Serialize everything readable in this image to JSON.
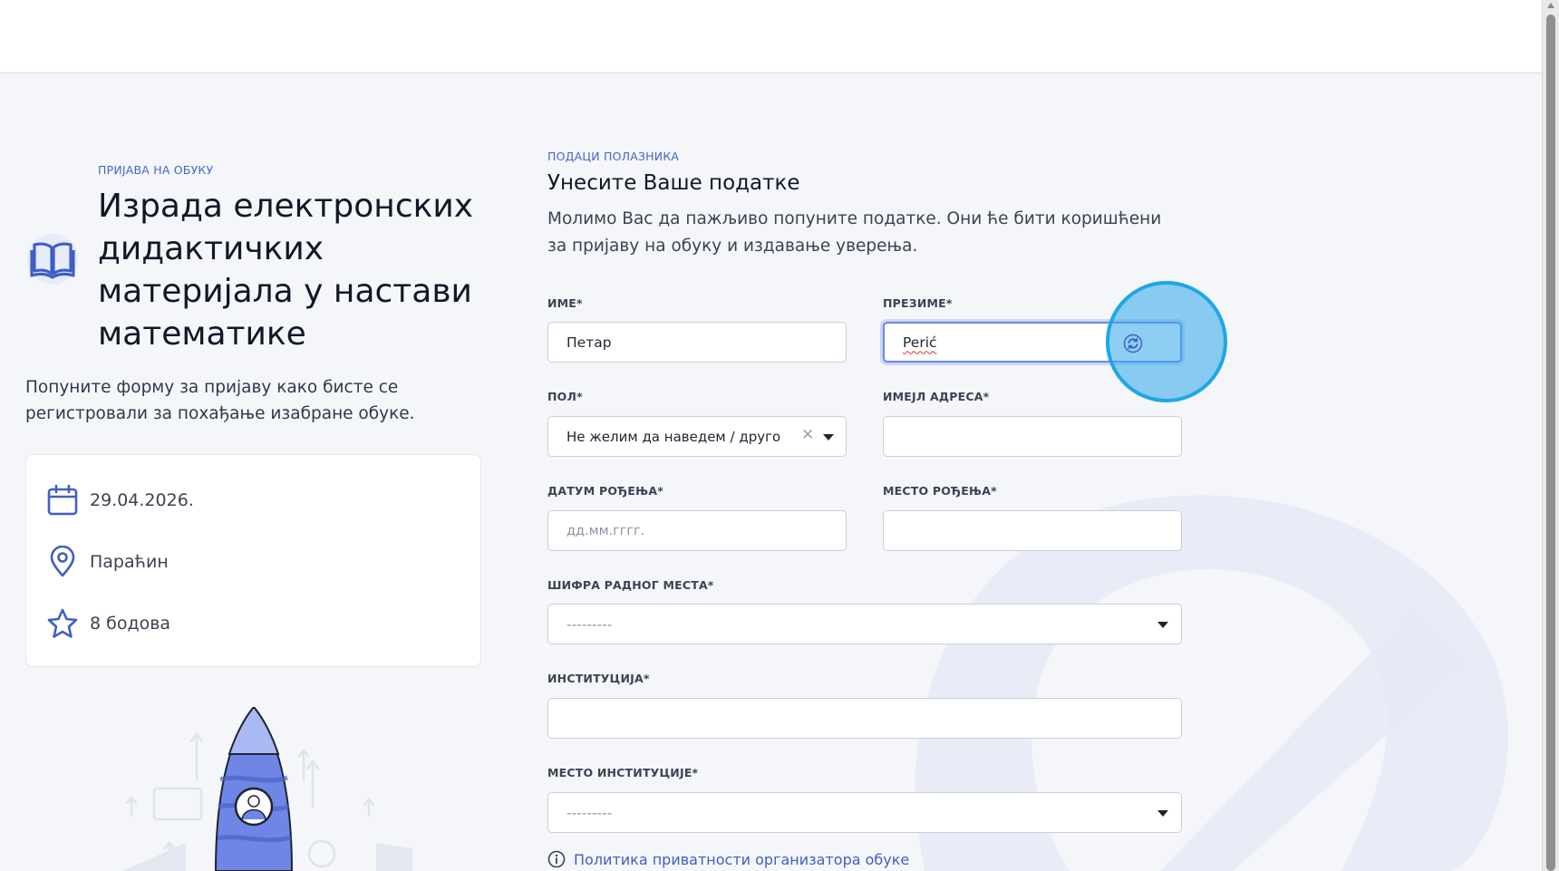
{
  "left": {
    "eyebrow": "ПРИЈАВА НА ОБУКУ",
    "course_title": "Израда електронских дидактичких материјала у настави математике",
    "intro": "Попуните форму за пријаву како бисте се регистровали за похађање изабране обуке.",
    "info": {
      "date": "29.04.2026.",
      "location": "Параћин",
      "points": "8 бодова"
    }
  },
  "form": {
    "eyebrow": "ПОДАЦИ ПОЛАЗНИКА",
    "title": "Унесите Ваше податке",
    "description": "Молимо Вас да пажљиво попуните податке. Они ће бити коришћени за пријаву на обуку и издавање уверења.",
    "fields": {
      "first_name": {
        "label": "ИМЕ*",
        "value": "Петар"
      },
      "last_name": {
        "label": "ПРЕЗИМЕ*",
        "value": "Perić"
      },
      "gender": {
        "label": "ПОЛ*",
        "value": "Не желим да наведем / друго"
      },
      "email": {
        "label": "ИМЕЈЛ АДРЕСА*",
        "value": ""
      },
      "birth_date": {
        "label": "ДАТУМ РОЂЕЊА*",
        "placeholder": "дд.мм.гггг."
      },
      "birth_place": {
        "label": "МЕСТО РОЂЕЊА*",
        "value": ""
      },
      "job_code": {
        "label": "ШИФРА РАДНОГ МЕСТА*",
        "value": "---------"
      },
      "institution": {
        "label": "ИНСТИТУЦИЈА*",
        "value": ""
      },
      "institution_place": {
        "label": "МЕСТО ИНСТИТУЦИЈЕ*",
        "value": "---------"
      }
    },
    "privacy_link": "Политика приватности организатора обуке"
  },
  "icons": {
    "book": "book-icon",
    "calendar": "calendar-icon",
    "location": "map-pin-icon",
    "points": "star-icon",
    "autofill": "refresh-icon",
    "info": "info-icon",
    "clear": "close-icon",
    "dropdown": "chevron-down-icon"
  },
  "colors": {
    "accent": "#4a63c8",
    "link": "#3f5fc4",
    "focus_ring": "#6f86e6",
    "click_indicator": "#1fa6e6",
    "page_bg": "#f4f6fa"
  }
}
